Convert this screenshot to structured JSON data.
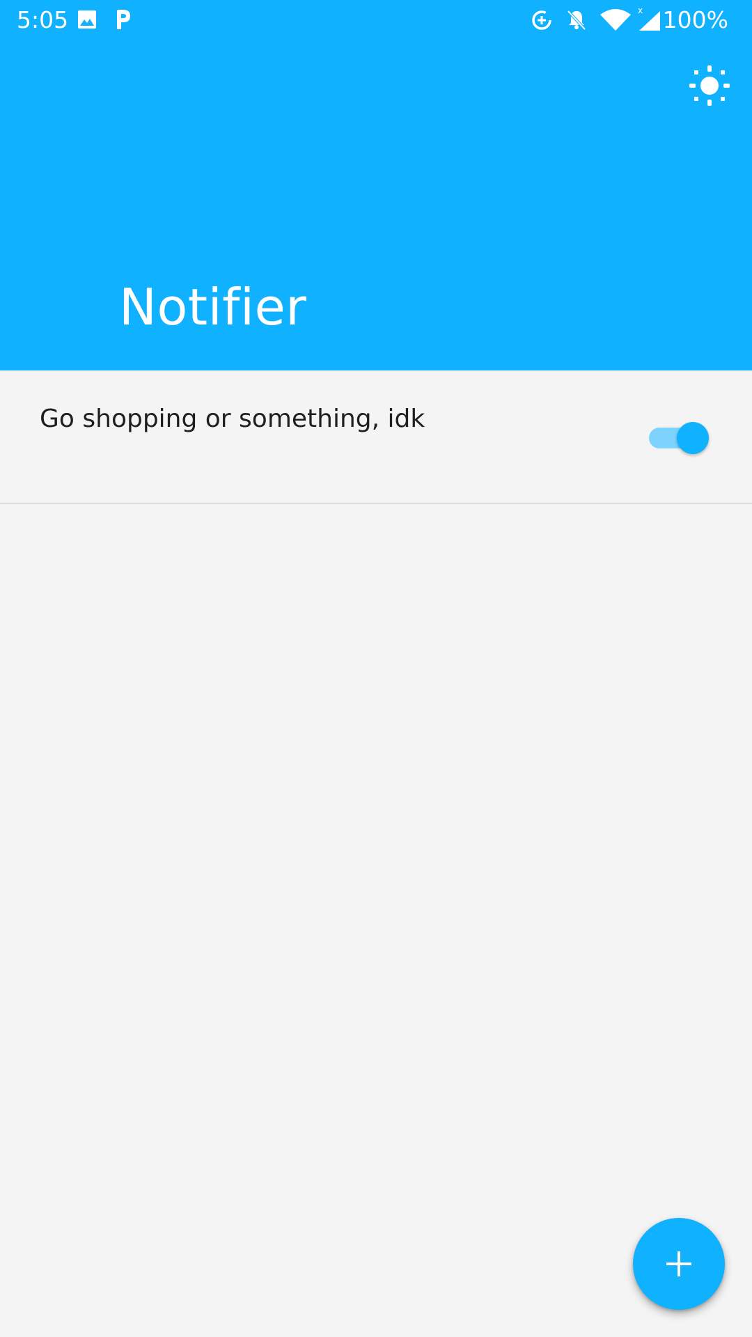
{
  "status_bar": {
    "time": "5:05",
    "battery": "100%",
    "icons": [
      "image-icon",
      "p-app-icon",
      "data-saver-icon",
      "bell-off-icon",
      "wifi-icon",
      "cell-signal-icon"
    ]
  },
  "header": {
    "title": "Notifier",
    "action_icon": "brightness-icon"
  },
  "reminders": [
    {
      "text": "Go shopping or something, idk",
      "enabled": true
    }
  ],
  "fab": {
    "icon": "plus-icon"
  },
  "colors": {
    "accent": "#10b1fe",
    "accent_light": "#7dd3fd",
    "background": "#f4f4f4",
    "text": "#1f1f1f"
  }
}
